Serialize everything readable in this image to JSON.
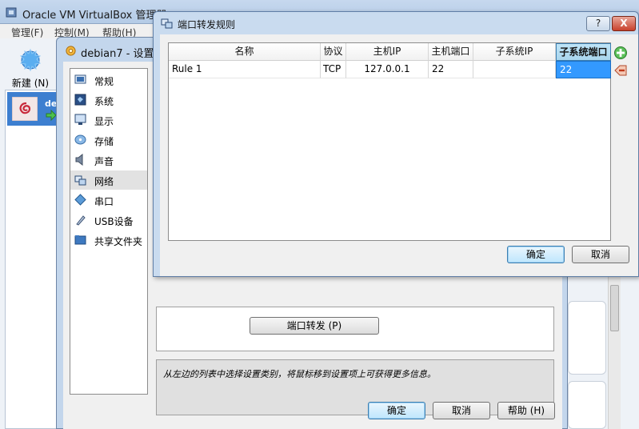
{
  "main_window": {
    "title": "Oracle VM VirtualBox 管理器",
    "menu": [
      "管理(F)",
      "控制(M)",
      "帮助(H)"
    ],
    "toolbar_new_label": "新建 (N)",
    "vm_name_short": "de"
  },
  "settings": {
    "title": "debian7 - 设置",
    "categories": [
      {
        "label": "常规",
        "icon": "general-icon"
      },
      {
        "label": "系统",
        "icon": "system-icon"
      },
      {
        "label": "显示",
        "icon": "display-icon"
      },
      {
        "label": "存储",
        "icon": "storage-icon"
      },
      {
        "label": "声音",
        "icon": "audio-icon"
      },
      {
        "label": "网络",
        "icon": "network-icon"
      },
      {
        "label": "串口",
        "icon": "serial-port-icon"
      },
      {
        "label": "USB设备",
        "icon": "usb-icon"
      },
      {
        "label": "共享文件夹",
        "icon": "shared-folder-icon"
      }
    ],
    "selected_category": "网络",
    "port_forward_button": "端口转发 (P)",
    "info_text": "从左边的列表中选择设置类别，将鼠标移到设置项上可获得更多信息。",
    "ok_label": "确定",
    "cancel_label": "取消",
    "help_label": "帮助 (H)"
  },
  "port_forwarding": {
    "title": "端口转发规则",
    "help_caption": "?",
    "close_caption": "X",
    "columns": [
      "名称",
      "协议",
      "主机IP",
      "主机端口",
      "子系统IP",
      "子系统端口"
    ],
    "active_column": "子系统端口",
    "rules": [
      {
        "name": "Rule 1",
        "protocol": "TCP",
        "host_ip": "127.0.0.1",
        "host_port": "22",
        "guest_ip": "",
        "guest_port": "22"
      }
    ],
    "ok_label": "确定",
    "cancel_label": "取消",
    "add_rule_icon": "add-rule-icon",
    "remove_rule_icon": "remove-rule-icon"
  },
  "colors": {
    "selection_blue": "#3399ff",
    "titlebar_blue": "#c9dbef",
    "close_red": "#c8412c"
  }
}
